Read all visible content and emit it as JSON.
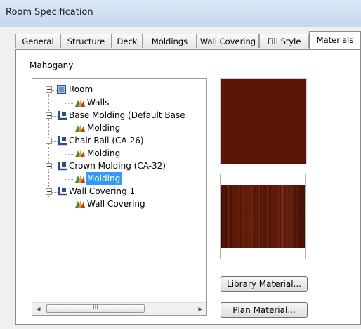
{
  "window": {
    "title": "Room Specification"
  },
  "tabs": [
    {
      "label": "General"
    },
    {
      "label": "Structure"
    },
    {
      "label": "Deck"
    },
    {
      "label": "Moldings"
    },
    {
      "label": "Wall Covering"
    },
    {
      "label": "Fill Style"
    },
    {
      "label": "Materials",
      "active": true
    }
  ],
  "material_name": "Mahogany",
  "tree": [
    {
      "label": "Room"
    },
    {
      "label": "Walls"
    },
    {
      "label": "Base Molding (Default Base"
    },
    {
      "label": "Molding"
    },
    {
      "label": "Chair Rail (CA-26)"
    },
    {
      "label": "Molding"
    },
    {
      "label": "Crown Molding (CA-32)"
    },
    {
      "label": "Molding",
      "selected": true
    },
    {
      "label": "Wall Covering 1"
    },
    {
      "label": "Wall Covering"
    }
  ],
  "scrollbar": {
    "thumb_grip": "III"
  },
  "buttons": {
    "library_material": "Library Material...",
    "plan_material": "Plan Material..."
  },
  "colors": {
    "material_base": "#5a1606",
    "selection": "#3399ff"
  }
}
